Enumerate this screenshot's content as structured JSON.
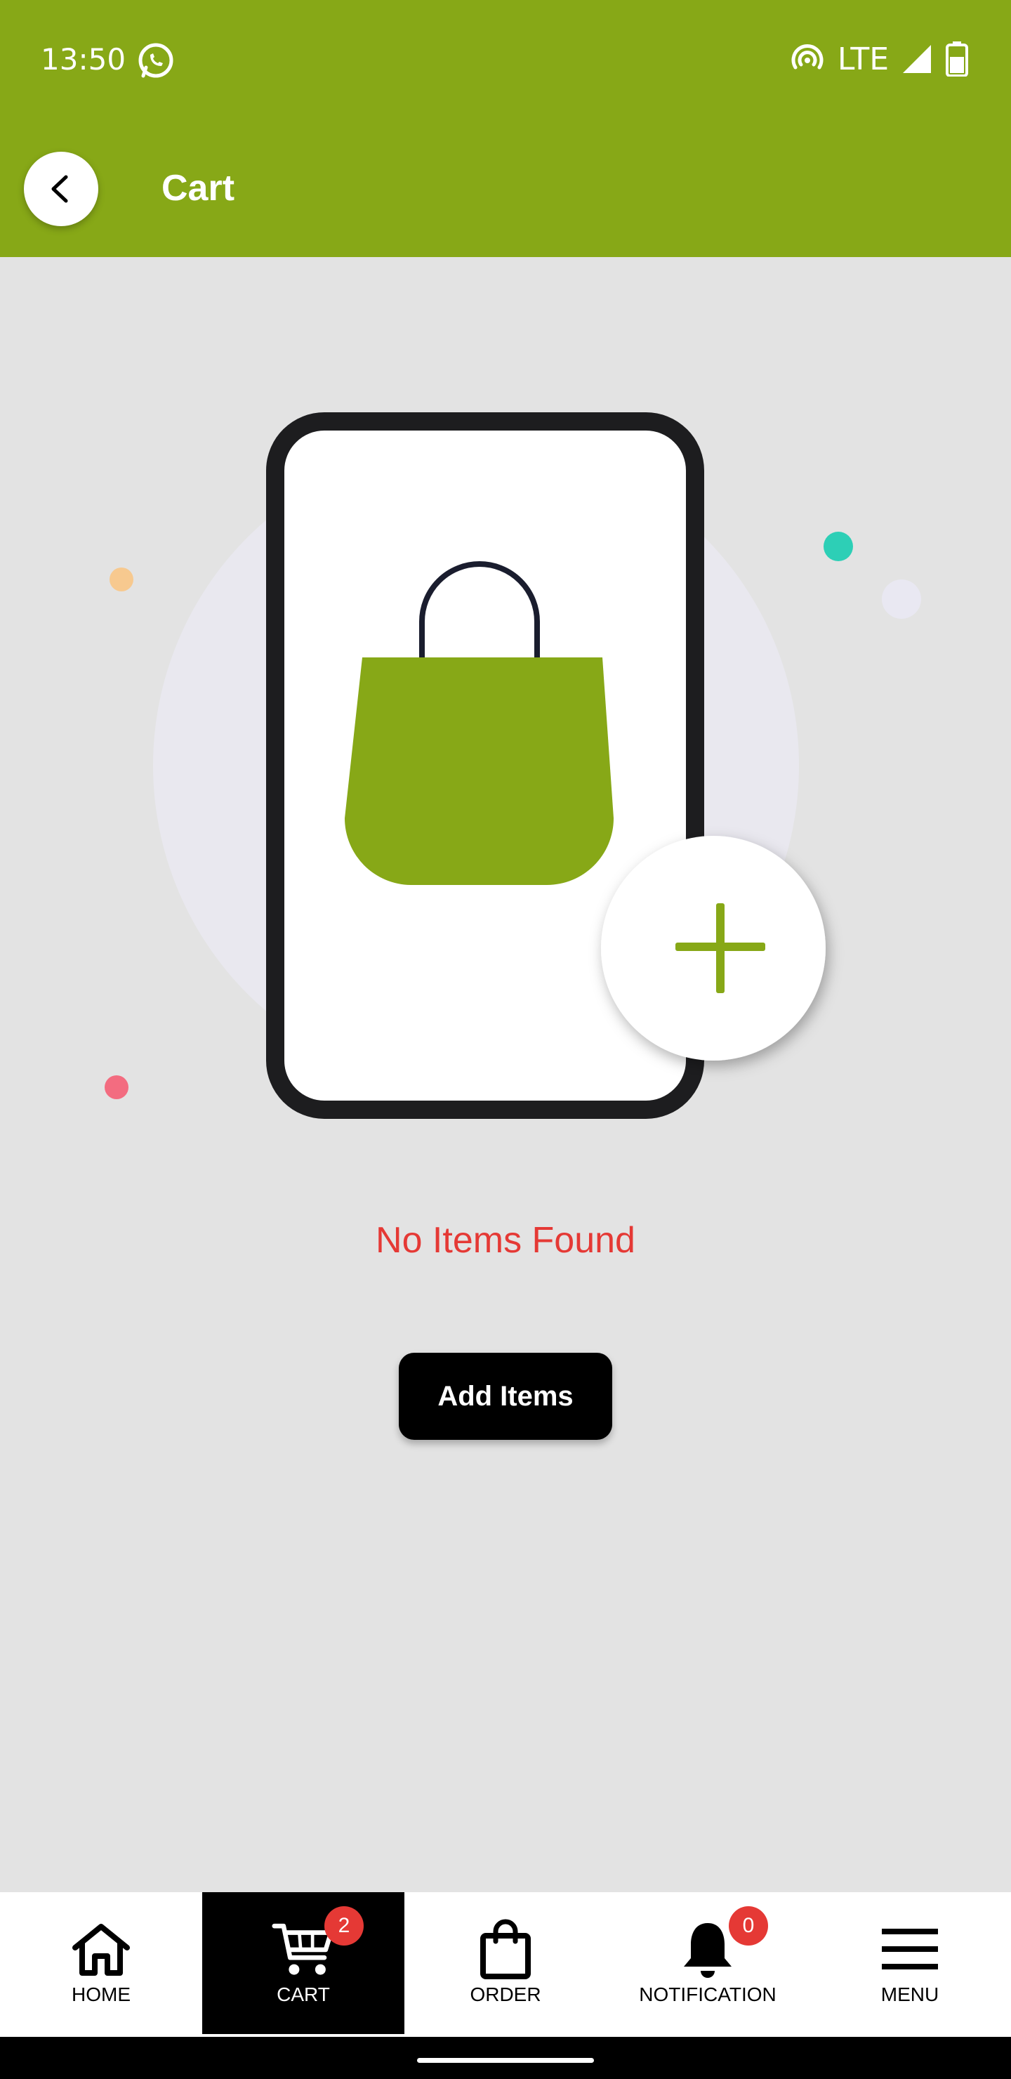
{
  "status": {
    "time": "13:50",
    "network": "LTE"
  },
  "app_bar": {
    "title": "Cart"
  },
  "empty_state": {
    "message": "No Items Found",
    "button_label": "Add Items"
  },
  "bottom_nav": {
    "items": [
      {
        "label": "HOME",
        "icon": "home-icon"
      },
      {
        "label": "CART",
        "icon": "cart-icon",
        "badge": "2"
      },
      {
        "label": "ORDER",
        "icon": "shopping-bag-icon"
      },
      {
        "label": "NOTIFICATION",
        "icon": "bell-icon",
        "badge": "0"
      },
      {
        "label": "MENU",
        "icon": "menu-icon"
      }
    ],
    "active": "CART"
  },
  "colors": {
    "primary": "#87a817",
    "error": "#e53935",
    "background": "#e3e3e3"
  }
}
